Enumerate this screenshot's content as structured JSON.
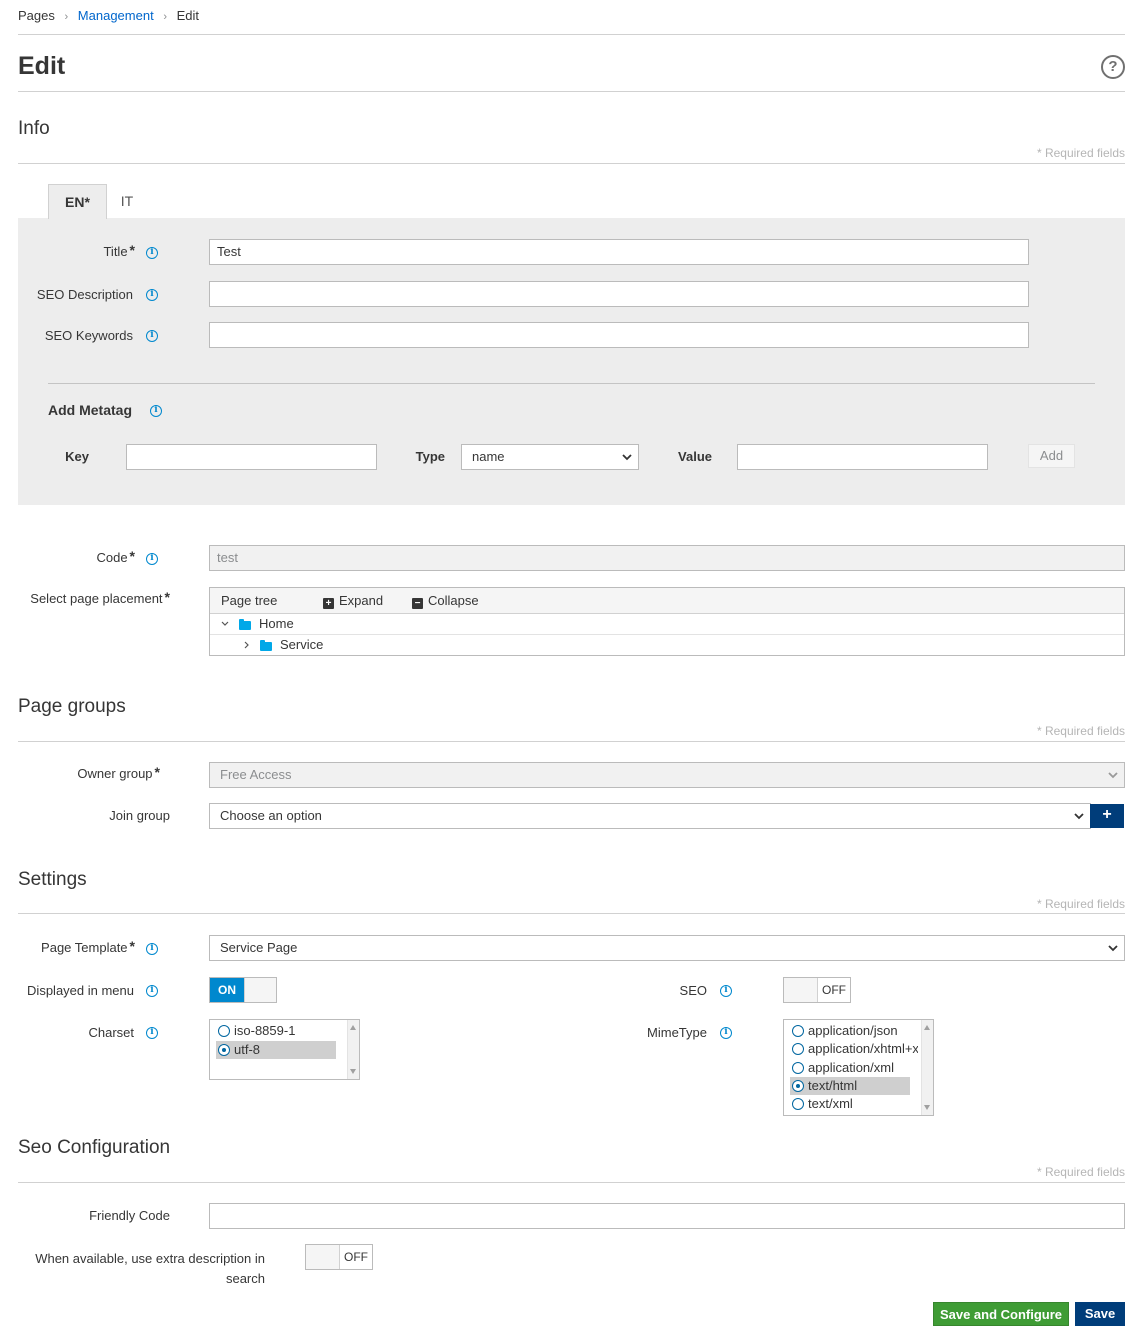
{
  "breadcrumb": [
    "Pages",
    "Management",
    "Edit"
  ],
  "page_title": "Edit",
  "required_note": "* Required fields",
  "info": {
    "section_title": "Info",
    "tabs": [
      "EN*",
      "IT"
    ],
    "title_label": "Title",
    "title_value": "Test",
    "seo_description_label": "SEO Description",
    "seo_description_value": "",
    "seo_keywords_label": "SEO Keywords",
    "seo_keywords_value": "",
    "metatag": {
      "title": "Add Metatag",
      "key_label": "Key",
      "key_value": "",
      "type_label": "Type",
      "type_value": "name",
      "value_label": "Value",
      "value_value": "",
      "add_button": "Add"
    },
    "code_label": "Code",
    "code_value": "test",
    "placement_label": "Select page placement",
    "tree": {
      "header": "Page tree",
      "expand": "Expand",
      "collapse": "Collapse",
      "nodes": [
        "Home",
        "Service"
      ]
    }
  },
  "groups": {
    "section_title": "Page groups",
    "owner_label": "Owner group",
    "owner_value": "Free Access",
    "join_label": "Join group",
    "join_value": "Choose an option",
    "add_symbol": "+"
  },
  "settings": {
    "section_title": "Settings",
    "template_label": "Page Template",
    "template_value": "Service Page",
    "menu_label": "Displayed in menu",
    "menu_state": "ON",
    "seo_label": "SEO",
    "seo_state": "OFF",
    "charset_label": "Charset",
    "charset_options": [
      "iso-8859-1",
      "utf-8"
    ],
    "charset_selected": "utf-8",
    "mimetype_label": "MimeType",
    "mimetype_options": [
      "application/json",
      "application/xhtml+x",
      "application/xml",
      "text/html",
      "text/xml"
    ],
    "mimetype_selected": "text/html"
  },
  "seo_config": {
    "section_title": "Seo Configuration",
    "friendly_label": "Friendly Code",
    "friendly_value": "",
    "extra_label_1": "When available, use extra description in",
    "extra_label_2": "search",
    "extra_state": "OFF"
  },
  "actions": {
    "save_configure": "Save and Configure",
    "save": "Save"
  },
  "colors": {
    "primary": "#0088ce",
    "dark_blue": "#003d7a",
    "green": "#3f9c35"
  }
}
